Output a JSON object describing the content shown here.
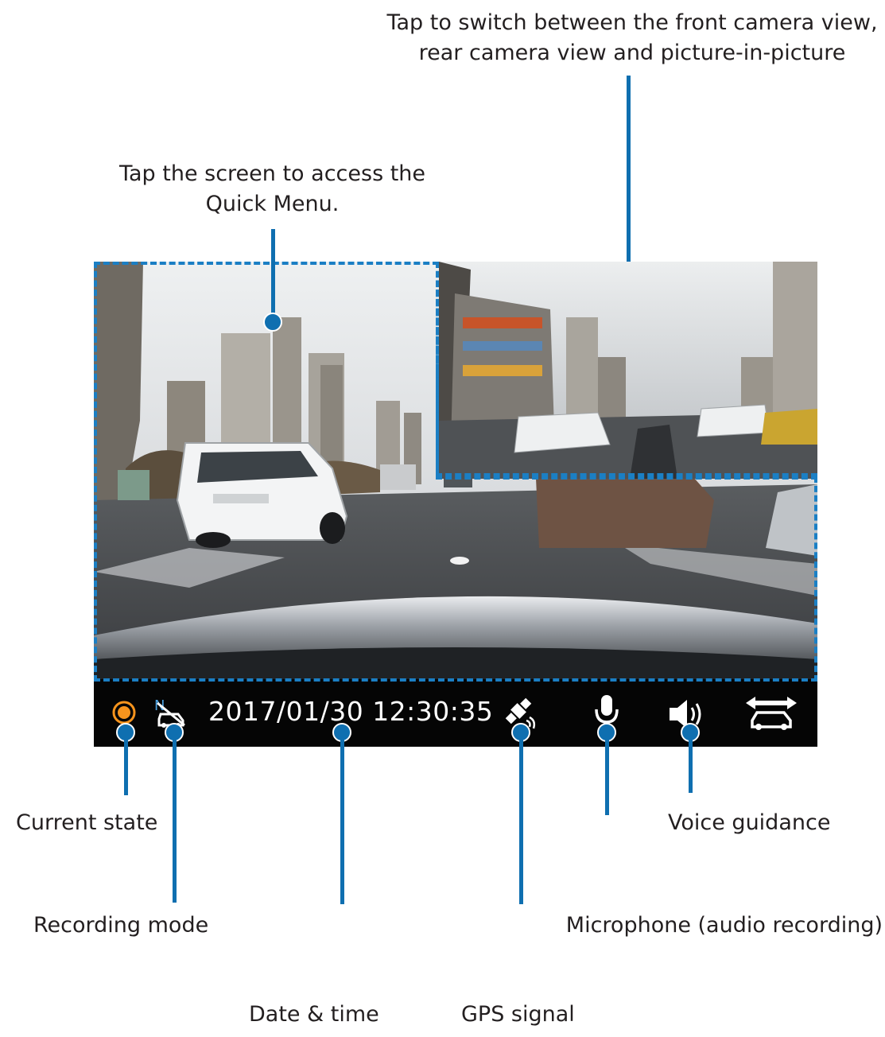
{
  "callouts": {
    "switch_view": "Tap to switch between the front camera view,",
    "switch_view_2": "rear camera view and picture-in-picture",
    "quick_menu": "Tap the screen to access the",
    "quick_menu_2": "Quick Menu.",
    "current_state": "Current state",
    "recording_mode": "Recording mode",
    "date_time": "Date & time",
    "gps_signal": "GPS signal",
    "microphone": "Microphone (audio recording)",
    "voice_guidance": "Voice guidance"
  },
  "status_bar": {
    "datetime": "2017/01/30 12:30:35",
    "icons": [
      "record-state-icon",
      "recording-mode-icon",
      "gps-signal-icon",
      "microphone-icon",
      "speaker-icon",
      "camera-switch-icon"
    ]
  },
  "colors": {
    "accent": "#0f6fb0",
    "record": "#f7941d",
    "status_bar": "#050505"
  }
}
